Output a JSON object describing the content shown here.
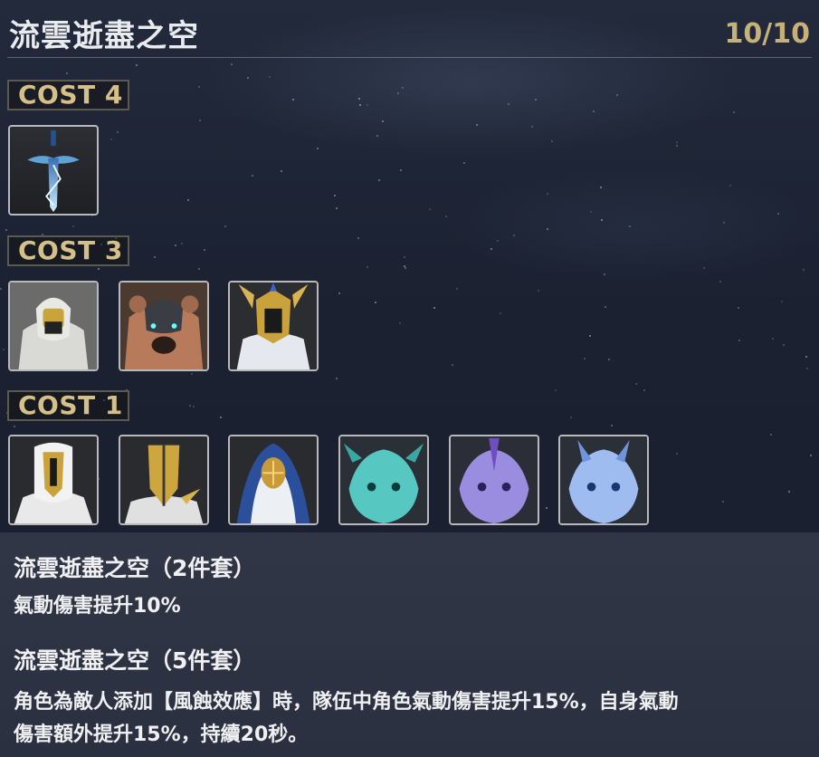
{
  "header": {
    "title": "流雲逝盡之空",
    "counter": "10/10"
  },
  "groups": [
    {
      "cost_label": "COST 4",
      "echoes": [
        "sword-echo-icon"
      ]
    },
    {
      "cost_label": "COST 3",
      "echoes": [
        "armored-knight-echo-icon",
        "bear-echo-icon",
        "winged-helm-echo-icon"
      ]
    },
    {
      "cost_label": "COST 1",
      "echoes": [
        "hooded-priest-echo-icon",
        "golden-mask-echo-icon",
        "nun-echo-icon",
        "teal-dragon-echo-icon",
        "violet-dragon-echo-icon",
        "blue-dragon-echo-icon"
      ]
    }
  ],
  "bonuses": [
    {
      "title": "流雲逝盡之空（2件套）",
      "desc_lines": [
        "氣動傷害提升10%"
      ]
    },
    {
      "title": "流雲逝盡之空（5件套）",
      "desc_lines": [
        "角色為敵人添加【風蝕效應】時，隊伍中角色氣動傷害提升15%，自身氣動",
        "傷害額外提升15%，持續20秒。"
      ]
    }
  ],
  "colors": {
    "gold": "#c7b17a",
    "badge_text": "#d6c08a",
    "slot_border": "#b9b9bd"
  }
}
